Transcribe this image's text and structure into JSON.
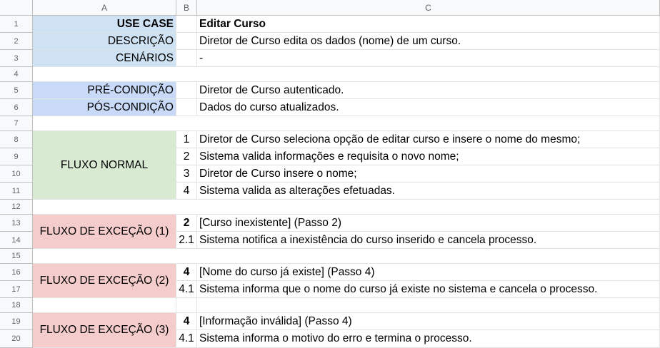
{
  "columns": [
    "A",
    "B",
    "C"
  ],
  "rows": [
    "1",
    "2",
    "3",
    "4",
    "5",
    "6",
    "7",
    "8",
    "9",
    "10",
    "11",
    "12",
    "13",
    "14",
    "15",
    "16",
    "17",
    "18",
    "19",
    "20"
  ],
  "cells": {
    "r1a": "USE CASE",
    "r1c": "Editar Curso",
    "r2a": "DESCRIÇÃO",
    "r2c": "Diretor de Curso edita os dados (nome) de um curso.",
    "r3a": "CENÁRIOS",
    "r3c": "-",
    "r5a": "PRÉ-CONDIÇÃO",
    "r5c": "Diretor de Curso autenticado.",
    "r6a": "PÓS-CONDIÇÃO",
    "r6c": "Dados do curso atualizados.",
    "fluxo_normal": "FLUXO NORMAL",
    "r8b": "1",
    "r8c": "Diretor de Curso seleciona opção de editar curso e insere o nome do mesmo;",
    "r9b": "2",
    "r9c": "Sistema valida informações e requisita o novo nome;",
    "r10b": "3",
    "r10c": "Diretor de Curso insere o nome;",
    "r11b": "4",
    "r11c": "Sistema valida as alterações efetuadas.",
    "excecao1": "FLUXO DE EXCEÇÃO (1)",
    "r13b": "2",
    "r13c": "[Curso inexistente] (Passo 2)",
    "r14b": "2.1",
    "r14c": "Sistema notifica a inexistência do curso inserido e cancela processo.",
    "excecao2": "FLUXO DE EXCEÇÃO (2)",
    "r16b": "4",
    "r16c": "[Nome do curso já existe] (Passo 4)",
    "r17b": "4.1",
    "r17c": "Sistema informa que o nome do curso já existe no sistema e cancela o processo.",
    "excecao3": "FLUXO DE EXCEÇÃO (3)",
    "r19b": "4",
    "r19c": "[Informação inválida] (Passo 4)",
    "r20b": "4.1",
    "r20c": "Sistema informa o motivo do erro e termina o processo."
  },
  "colors": {
    "header_bg": "#f8f9fa",
    "blue_light": "#cfe2f3",
    "blue": "#c9daf8",
    "green": "#d9ead3",
    "red": "#f4cccc"
  }
}
